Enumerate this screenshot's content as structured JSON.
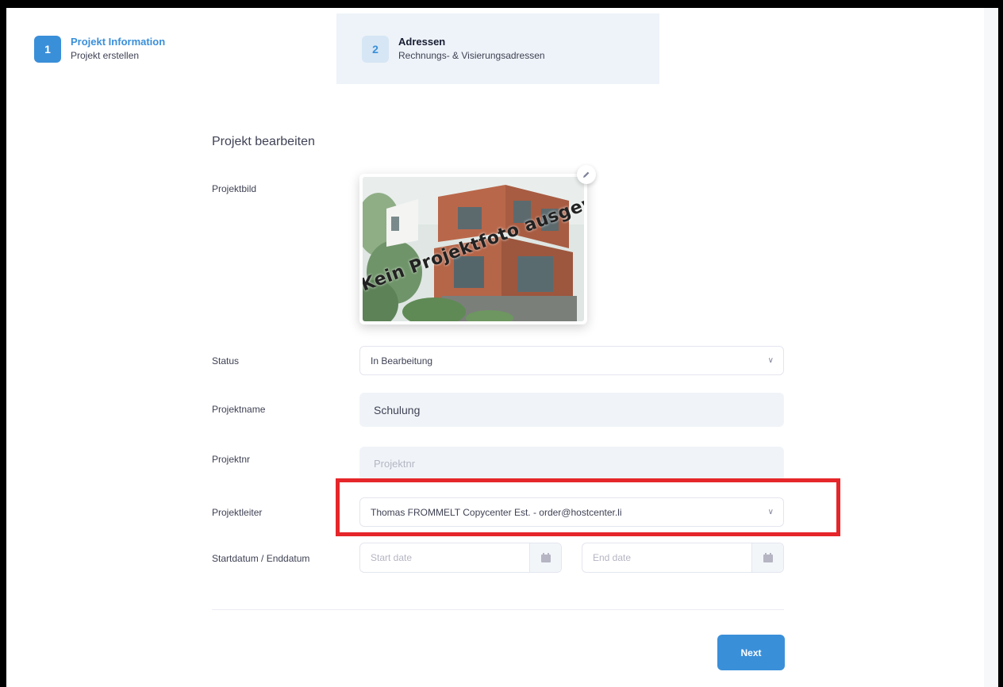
{
  "stepper": {
    "steps": [
      {
        "number": "1",
        "title": "Projekt Information",
        "subtitle": "Projekt erstellen",
        "state": "active"
      },
      {
        "number": "2",
        "title": "Adressen",
        "subtitle": "Rechnungs- & Visierungsadressen",
        "state": "pending"
      }
    ]
  },
  "form": {
    "title": "Projekt bearbeiten",
    "image": {
      "label": "Projektbild",
      "overlay_text": "Kein Projektfoto ausgewählt",
      "edit_icon": "pencil-icon"
    },
    "status": {
      "label": "Status",
      "value": "In Bearbeitung"
    },
    "projektname": {
      "label": "Projektname",
      "value": "Schulung"
    },
    "projektnr": {
      "label": "Projektnr",
      "placeholder": "Projektnr"
    },
    "projektleiter": {
      "label": "Projektleiter",
      "value": "Thomas FROMMELT Copycenter Est. - order@hostcenter.li"
    },
    "dates": {
      "label": "Startdatum / Enddatum",
      "start_placeholder": "Start date",
      "end_placeholder": "End date",
      "icon": "calendar-icon"
    }
  },
  "actions": {
    "next_label": "Next"
  },
  "colors": {
    "accent": "#3a8fd9",
    "highlight": "#e5262a",
    "input_bg": "#f0f4f8",
    "step_bg": "#edf3f8"
  }
}
